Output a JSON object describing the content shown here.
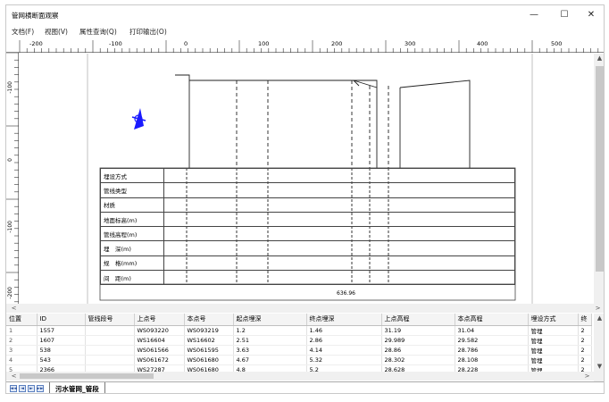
{
  "window": {
    "title": "管网横断面观察",
    "minimize_glyph": "—",
    "maximize_glyph": "☐",
    "close_glyph": "✕"
  },
  "menu": [
    "文档(F)",
    "视图(V)",
    "属性查询(Q)",
    "打印输出(O)"
  ],
  "ruler": {
    "corner": "L",
    "h_ticks": [
      "-200",
      "-100",
      "0",
      "100",
      "200",
      "300",
      "400",
      "500"
    ],
    "v_ticks": [
      "-100",
      "0",
      "-100",
      "-200"
    ]
  },
  "profile": {
    "row_labels": [
      "埋设方式",
      "管线类型",
      "材质",
      "地面标高(m)",
      "管线高程(m)",
      "埋　深(m)",
      "规　格(mm)",
      "间　距(m)"
    ],
    "total_distance": "636.96"
  },
  "grid": {
    "columns": [
      "位置",
      "ID",
      "管线段号",
      "上点号",
      "本点号",
      "起点埋深",
      "终点埋深",
      "上点高程",
      "本点高程",
      "埋设方式",
      "终"
    ],
    "rows": [
      [
        "1",
        "1557",
        "",
        "WS093220",
        "WS093219",
        "1.2",
        "1.46",
        "31.19",
        "31.04",
        "管埋",
        "2"
      ],
      [
        "2",
        "1607",
        "",
        "WS16604",
        "WS16602",
        "2.51",
        "2.86",
        "29.989",
        "29.582",
        "管埋",
        "2"
      ],
      [
        "3",
        "538",
        "",
        "WS061566",
        "WS061595",
        "3.63",
        "4.14",
        "28.86",
        "28.786",
        "管埋",
        "2"
      ],
      [
        "4",
        "543",
        "",
        "WS061672",
        "WS061680",
        "4.67",
        "5.32",
        "28.302",
        "28.108",
        "管埋",
        "2"
      ],
      [
        "5",
        "2366",
        "",
        "WS27287",
        "WS061680",
        "4.8",
        "5.2",
        "28.628",
        "28.228",
        "管埋",
        "2"
      ]
    ]
  },
  "tabs": {
    "active": "污水管网_管段"
  },
  "icons": {
    "north_arrow": "north-arrow-icon",
    "nav_first": "◄◄",
    "nav_prev": "◄",
    "nav_next": "►",
    "nav_last": "►►",
    "scroll_up": "▲",
    "scroll_down": "▼",
    "scroll_left": "<",
    "scroll_right": ">"
  }
}
